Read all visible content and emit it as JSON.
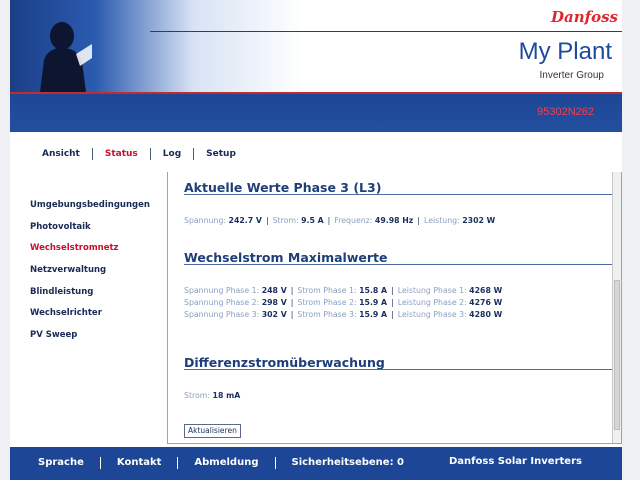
{
  "header": {
    "brand": "Danfoss",
    "title": "My Plant",
    "subtitle": "Inverter Group",
    "serial": "95302N262"
  },
  "topnav": [
    "Ansicht",
    "Status",
    "Log",
    "Setup"
  ],
  "topnav_active": "Status",
  "sidebar": [
    "Umgebungsbedingungen",
    "Photovoltaik",
    "Wechselstromnetz",
    "Netzverwaltung",
    "Blindleistung",
    "Wechselrichter",
    "PV Sweep"
  ],
  "sidebar_active": "Wechselstromnetz",
  "content": {
    "phase3": {
      "title": "Aktuelle Werte Phase 3 (L3)",
      "items": [
        {
          "label": "Spannung:",
          "value": "242.7 V"
        },
        {
          "label": "Strom:",
          "value": "9.5 A"
        },
        {
          "label": "Frequenz:",
          "value": "49.98 Hz"
        },
        {
          "label": "Leistung:",
          "value": "2302 W"
        }
      ]
    },
    "max": {
      "title": "Wechselstrom Maximalwerte",
      "rows": [
        [
          {
            "label": "Spannung Phase 1:",
            "value": "248 V"
          },
          {
            "label": "Strom Phase 1:",
            "value": "15.8 A"
          },
          {
            "label": "Leistung Phase 1:",
            "value": "4268 W"
          }
        ],
        [
          {
            "label": "Spannung Phase 2:",
            "value": "298 V"
          },
          {
            "label": "Strom Phase 2:",
            "value": "15.9 A"
          },
          {
            "label": "Leistung Phase 2:",
            "value": "4276 W"
          }
        ],
        [
          {
            "label": "Spannung Phase 3:",
            "value": "302 V"
          },
          {
            "label": "Strom Phase 3:",
            "value": "15.9 A"
          },
          {
            "label": "Leistung Phase 3:",
            "value": "4280 W"
          }
        ]
      ]
    },
    "diff": {
      "title": "Differenzstromüberwachung",
      "items": [
        {
          "label": "Strom:",
          "value": "18 mA"
        }
      ]
    },
    "refresh_label": "Aktualisieren"
  },
  "footer": {
    "items": [
      "Sprache",
      "Kontakt",
      "Abmeldung",
      "Sicherheitsebene: 0"
    ],
    "brand": "Danfoss Solar Inverters"
  },
  "colors": {
    "primary_blue": "#1d4796",
    "active_red": "#c8102e",
    "label_gray_blue": "#8aa0c0"
  }
}
